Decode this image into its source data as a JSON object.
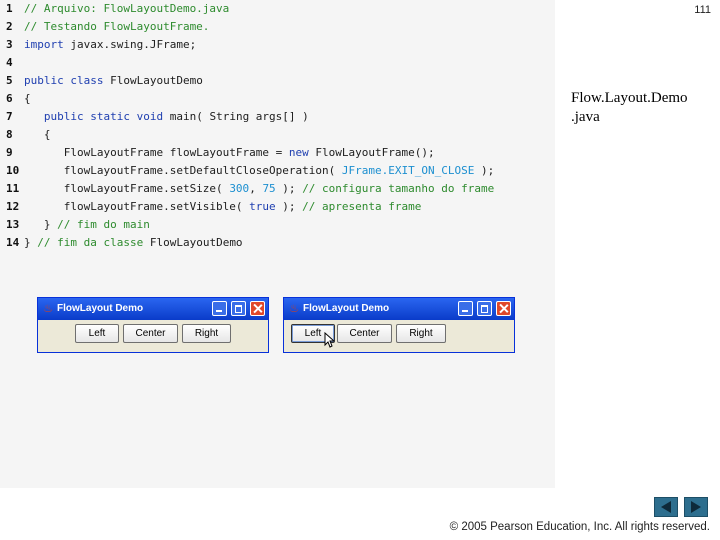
{
  "slide_number": "111",
  "side_title": [
    "Flow.Layout.Demo",
    ".java"
  ],
  "code_lines": [
    {
      "n": "1",
      "tokens": [
        {
          "t": "// Arquivo: FlowLayoutDemo.java",
          "c": "cm"
        }
      ]
    },
    {
      "n": "2",
      "tokens": [
        {
          "t": "// Testando FlowLayoutFrame.",
          "c": "cm"
        }
      ]
    },
    {
      "n": "3",
      "tokens": [
        {
          "t": "import",
          "c": "kw"
        },
        {
          "t": " javax.swing.JFrame;",
          "c": "pl"
        }
      ]
    },
    {
      "n": "4",
      "tokens": []
    },
    {
      "n": "5",
      "tokens": [
        {
          "t": "public class",
          "c": "kw"
        },
        {
          "t": " FlowLayoutDemo",
          "c": "pl"
        }
      ]
    },
    {
      "n": "6",
      "tokens": [
        {
          "t": "{",
          "c": "pl"
        }
      ]
    },
    {
      "n": "7",
      "tokens": [
        {
          "t": "   ",
          "c": "pl"
        },
        {
          "t": "public static void",
          "c": "kw"
        },
        {
          "t": " main( String args[] )",
          "c": "pl"
        }
      ]
    },
    {
      "n": "8",
      "tokens": [
        {
          "t": "   {",
          "c": "pl"
        }
      ]
    },
    {
      "n": "9",
      "tokens": [
        {
          "t": "      FlowLayoutFrame flowLayoutFrame = ",
          "c": "pl"
        },
        {
          "t": "new",
          "c": "kw"
        },
        {
          "t": " FlowLayoutFrame();",
          "c": "pl"
        }
      ]
    },
    {
      "n": "10",
      "tokens": [
        {
          "t": "      flowLayoutFrame.setDefaultCloseOperation( ",
          "c": "pl"
        },
        {
          "t": "JFrame.EXIT_ON_CLOSE",
          "c": "co"
        },
        {
          "t": " );",
          "c": "pl"
        }
      ]
    },
    {
      "n": "11",
      "tokens": [
        {
          "t": "      flowLayoutFrame.setSize( ",
          "c": "pl"
        },
        {
          "t": "300",
          "c": "co"
        },
        {
          "t": ", ",
          "c": "pl"
        },
        {
          "t": "75",
          "c": "co"
        },
        {
          "t": " ); ",
          "c": "pl"
        },
        {
          "t": "// configura tamanho do frame",
          "c": "cm"
        }
      ]
    },
    {
      "n": "12",
      "tokens": [
        {
          "t": "      flowLayoutFrame.setVisible( ",
          "c": "pl"
        },
        {
          "t": "true",
          "c": "kw"
        },
        {
          "t": " ); ",
          "c": "pl"
        },
        {
          "t": "// apresenta frame",
          "c": "cm"
        }
      ]
    },
    {
      "n": "13",
      "tokens": [
        {
          "t": "   } ",
          "c": "pl"
        },
        {
          "t": "// fim do main",
          "c": "cm"
        }
      ]
    },
    {
      "n": "14",
      "tokens": [
        {
          "t": "} ",
          "c": "pl"
        },
        {
          "t": "// fim da classe ",
          "c": "cm"
        },
        {
          "t": "FlowLayoutDemo",
          "c": "pl"
        }
      ]
    }
  ],
  "windows": [
    {
      "title": "FlowLayout Demo",
      "buttons": [
        "Left",
        "Center",
        "Right"
      ],
      "focused": ""
    },
    {
      "title": "FlowLayout Demo",
      "buttons": [
        "Left",
        "Center",
        "Right"
      ],
      "focused": "Left"
    }
  ],
  "icons": {
    "title_icon": "java-cup-icon",
    "minimize": "minimize-icon",
    "maximize": "maximize-icon",
    "close": "close-icon",
    "cursor": "mouse-pointer-icon",
    "prev": "previous-slide-icon",
    "next": "next-slide-icon"
  },
  "colors": {
    "comment": "#2e8b2e",
    "keyword": "#1f3fb0",
    "constant": "#1c8fd0",
    "titlebar": "#0a3bc9",
    "nav_button": "#2d6e8e"
  },
  "copyright": "© 2005 Pearson Education, Inc.  All rights reserved."
}
